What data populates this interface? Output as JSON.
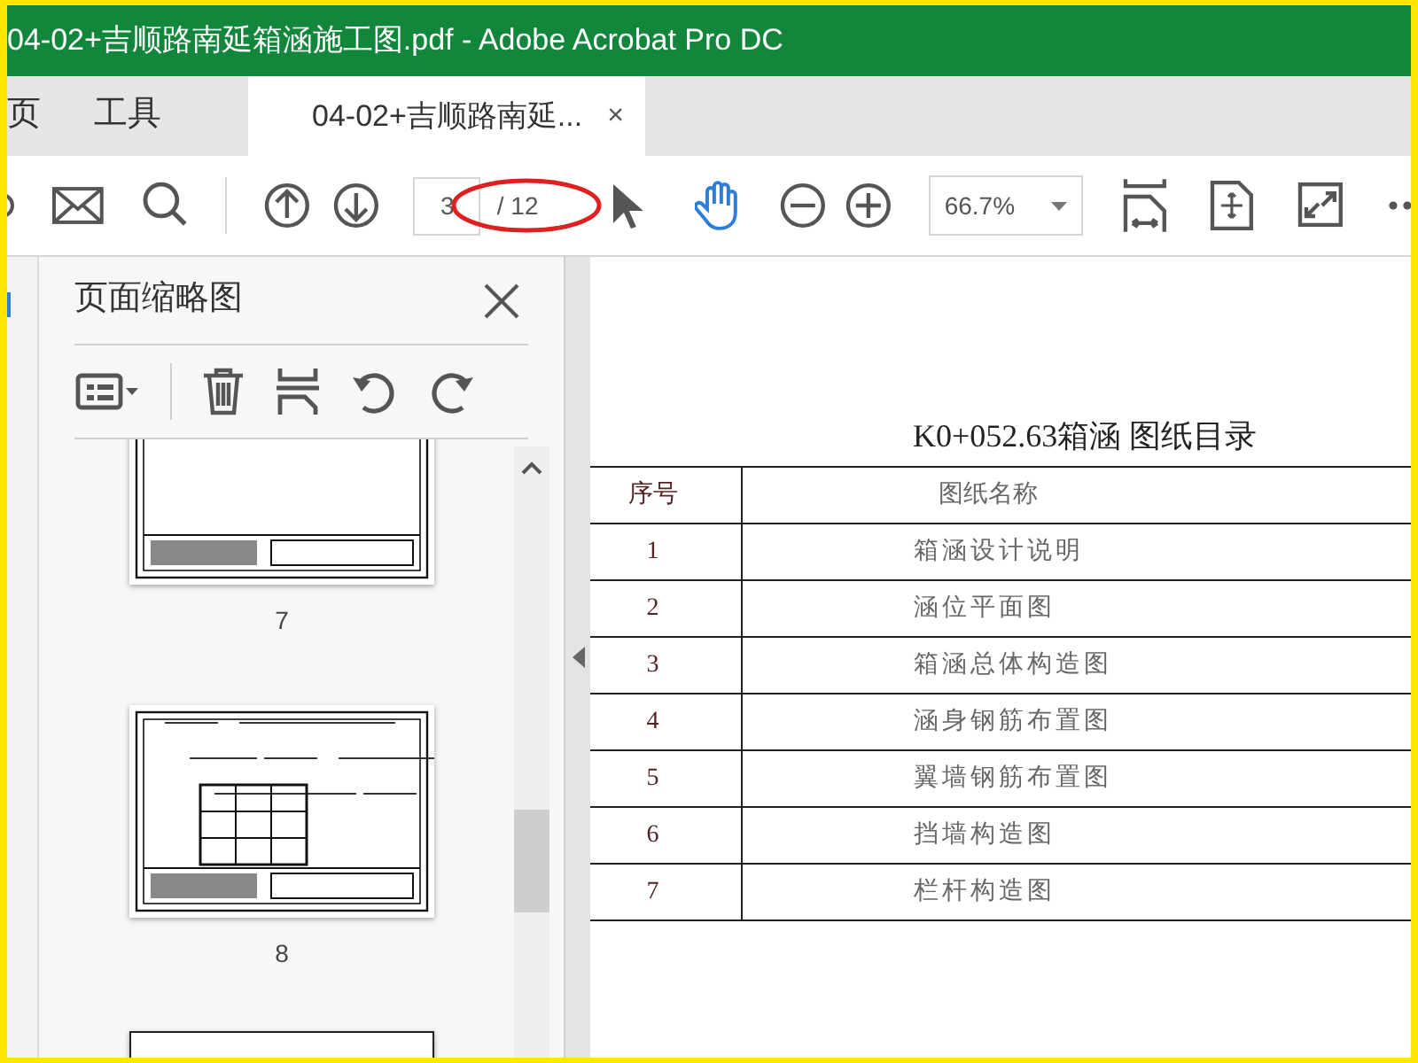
{
  "window": {
    "title": "04-02+吉顺路南延箱涵施工图.pdf - Adobe Acrobat Pro DC"
  },
  "tabs": [
    {
      "label": "页",
      "selected": false
    },
    {
      "label": "工具",
      "selected": false
    },
    {
      "label": "04-02+吉顺路南延...",
      "selected": true,
      "close": "×"
    }
  ],
  "toolbar": {
    "page_number": "3",
    "page_total": "/ 12",
    "zoom": "66.7%",
    "tools": [
      {
        "selected": false
      },
      {
        "selected": true
      }
    ]
  },
  "thumbnails_panel": {
    "title": "页面缩略图",
    "pages": [
      {
        "label": "7",
        "selected": false
      },
      {
        "label": "8",
        "selected": false
      }
    ]
  },
  "document": {
    "title": "K0+052.63箱涵 图纸目录",
    "columns": [
      "序号",
      "图纸名称"
    ],
    "rows": [
      [
        "1",
        "箱涵设计说明"
      ],
      [
        "2",
        "涵位平面图"
      ],
      [
        "3",
        "箱涵总体构造图"
      ],
      [
        "4",
        "涵身钢筋布置图"
      ],
      [
        "5",
        "翼墙钢筋布置图"
      ],
      [
        "6",
        "挡墙构造图"
      ],
      [
        "7",
        "栏杆构造图"
      ]
    ]
  }
}
